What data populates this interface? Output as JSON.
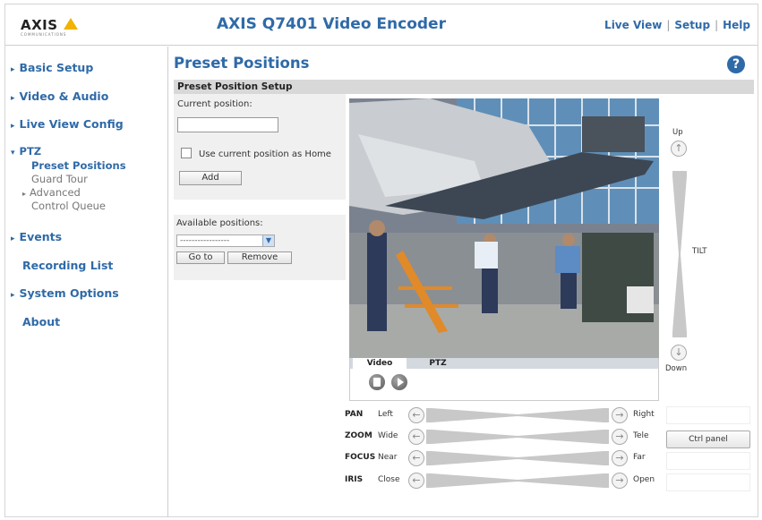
{
  "header": {
    "logo_text": "AXIS",
    "logo_sub": "COMMUNICATIONS",
    "app_title": "AXIS Q7401 Video Encoder",
    "links": [
      "Live View",
      "Setup",
      "Help"
    ]
  },
  "sidebar": {
    "items": [
      {
        "label": "Basic Setup"
      },
      {
        "label": "Video & Audio"
      },
      {
        "label": "Live View Config"
      },
      {
        "label": "PTZ"
      },
      {
        "label": "Events"
      },
      {
        "label": "Recording List"
      },
      {
        "label": "System Options"
      },
      {
        "label": "About"
      }
    ],
    "ptz_subitems": [
      "Preset Positions",
      "Guard Tour",
      "Advanced",
      "Control Queue"
    ]
  },
  "main": {
    "page_title": "Preset Positions",
    "help_icon": "?",
    "section_title": "Preset Position Setup",
    "current_position_label": "Current position:",
    "current_position_value": "",
    "use_home_label": "Use current position as Home",
    "add_label": "Add",
    "available_label": "Available positions:",
    "available_selected": "-----------------",
    "goto_label": "Go to",
    "remove_label": "Remove"
  },
  "video": {
    "tabs": [
      "Video",
      "PTZ"
    ],
    "active_tab": "Video"
  },
  "ptz": {
    "tilt_up": "Up",
    "tilt_down": "Down",
    "tilt_label": "TILT",
    "rows": [
      {
        "name": "PAN",
        "min": "Left",
        "max": "Right"
      },
      {
        "name": "ZOOM",
        "min": "Wide",
        "max": "Tele"
      },
      {
        "name": "FOCUS",
        "min": "Near",
        "max": "Far"
      },
      {
        "name": "IRIS",
        "min": "Close",
        "max": "Open"
      }
    ],
    "ctrl_panel_label": "Ctrl panel"
  },
  "colors": {
    "accent": "#2f6aa8",
    "logo_yellow": "#f2b200"
  },
  "icons": {
    "help": "help-icon",
    "up": "arrow-up-icon",
    "down": "arrow-down-icon",
    "left": "arrow-left-icon",
    "right": "arrow-right-icon",
    "stop": "stop-icon",
    "play": "play-icon"
  }
}
